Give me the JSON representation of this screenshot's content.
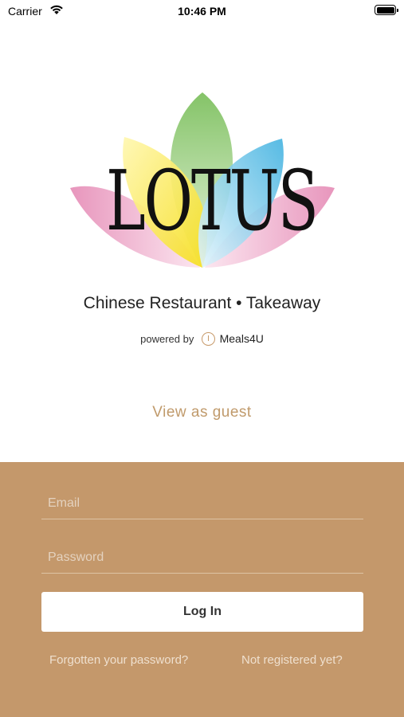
{
  "status_bar": {
    "carrier": "Carrier",
    "time": "10:46 PM"
  },
  "logo": {
    "text": "LOTUS",
    "petal_colors": [
      "#e58ab5",
      "#f6de1c",
      "#77bd57",
      "#3fb1e0",
      "#e58ab5"
    ]
  },
  "restaurant": {
    "subtitle": "Chinese Restaurant • Takeaway"
  },
  "powered_by": {
    "label": "powered by",
    "brand": "Meals4U"
  },
  "guest_link": "View as guest",
  "login_form": {
    "email_placeholder": "Email",
    "password_placeholder": "Password",
    "login_label": "Log In",
    "forgot_label": "Forgotten your password?",
    "register_label": "Not registered yet?"
  },
  "colors": {
    "panel_background": "#c4986b",
    "accent": "#c09a6b"
  }
}
